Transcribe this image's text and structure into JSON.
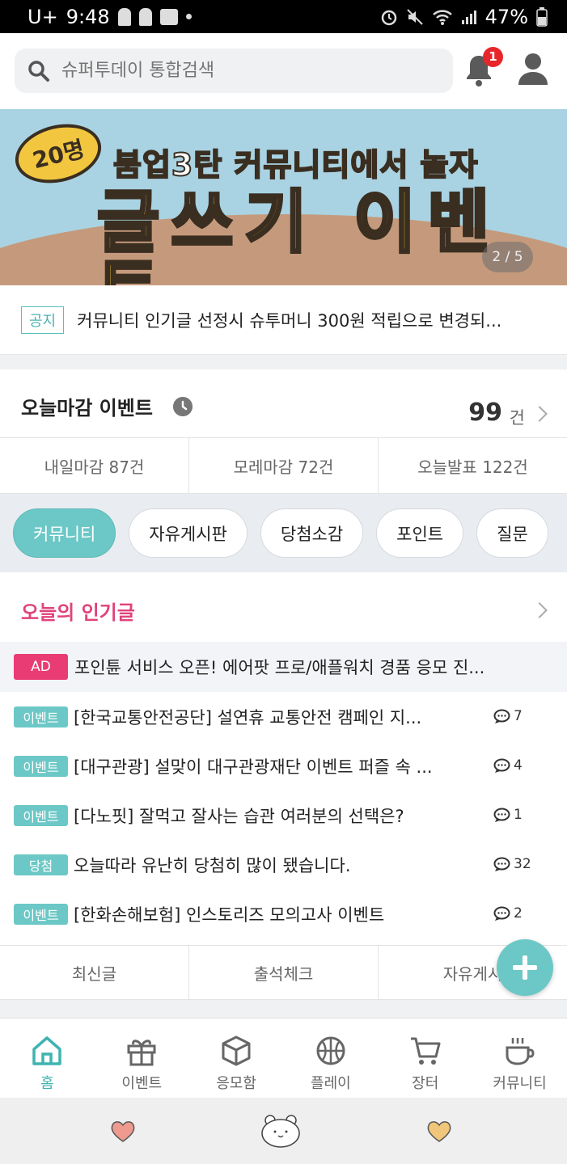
{
  "status_bar": {
    "carrier": "U+",
    "time": "9:48",
    "battery": "47%"
  },
  "header": {
    "search_placeholder": "슈퍼투데이 통합검색",
    "notification_count": "1"
  },
  "banner": {
    "bubble_text": "20명",
    "headline": "붐업3탄 커뮤니티에서 놀자",
    "title": "글쓰기 이벤트",
    "pager": "2 / 5"
  },
  "notice": {
    "tag": "공지",
    "text": "커뮤니티 인기글 선정시 슈투머니 300원 적립으로 변경되..."
  },
  "deadline": {
    "title": "오늘마감 이벤트",
    "count": "99",
    "unit": "건",
    "tabs": [
      "내일마감 87건",
      "모레마감 72건",
      "오늘발표 122건"
    ]
  },
  "chips": [
    "커뮤니티",
    "자유게시판",
    "당첨소감",
    "포인트",
    "질문"
  ],
  "popular": {
    "title": "오늘의 인기글",
    "ad": {
      "tag": "AD",
      "text": "포인튠 서비스 오픈! 에어팟 프로/애플워치 경품 응모 진..."
    },
    "posts": [
      {
        "tag": "이벤트",
        "text": "[한국교통안전공단] 설연휴 교통안전 캠페인 지...",
        "comments": "7"
      },
      {
        "tag": "이벤트",
        "text": "[대구관광] 설맞이 대구관광재단 이벤트 퍼즐 속 ...",
        "comments": "4"
      },
      {
        "tag": "이벤트",
        "text": "[다노핏] 잘먹고 잘사는 습관 여러분의 선택은?",
        "comments": "1"
      },
      {
        "tag": "당첨",
        "text": "오늘따라 유난히 당첨히 많이 됐습니다.",
        "comments": "32"
      },
      {
        "tag": "이벤트",
        "text": "[한화손해보험] 인스토리즈 모의고사 이벤트",
        "comments": "2"
      }
    ]
  },
  "bottom_tabs": [
    "최신글",
    "출석체크",
    "자유게시"
  ],
  "nav": [
    {
      "label": "홈",
      "icon": "home-icon"
    },
    {
      "label": "이벤트",
      "icon": "gift-icon"
    },
    {
      "label": "응모함",
      "icon": "box-icon"
    },
    {
      "label": "플레이",
      "icon": "ball-icon"
    },
    {
      "label": "장터",
      "icon": "cart-icon"
    },
    {
      "label": "커뮤니티",
      "icon": "cup-icon"
    }
  ],
  "colors": {
    "accent": "#6cc8c6",
    "popular_title": "#e0437b",
    "ad_tag": "#ea3c74",
    "badge": "#e8262a"
  }
}
